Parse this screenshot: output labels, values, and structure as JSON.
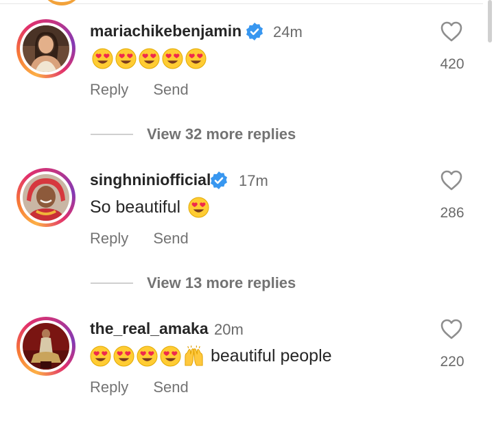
{
  "comments": [
    {
      "username": "mariachikebenjamin",
      "verified": true,
      "time": "24m",
      "text": "",
      "emojis": [
        "heart-eyes-emoji",
        "heart-eyes-emoji",
        "heart-eyes-emoji",
        "heart-eyes-emoji",
        "heart-eyes-emoji"
      ],
      "reply_label": "Reply",
      "send_label": "Send",
      "likes": "420",
      "view_more": "View 32 more replies"
    },
    {
      "username": "singhniniofficial",
      "verified": true,
      "time": "17m",
      "text": "So beautiful",
      "emojis": [
        "heart-eyes-emoji"
      ],
      "reply_label": "Reply",
      "send_label": "Send",
      "likes": "286",
      "view_more": "View 13 more replies"
    },
    {
      "username": "the_real_amaka",
      "verified": false,
      "time": "20m",
      "text": "beautiful people",
      "emojis": [
        "heart-eyes-emoji",
        "heart-eyes-emoji",
        "heart-eyes-emoji",
        "heart-eyes-emoji",
        "raising-hands-emoji"
      ],
      "reply_label": "Reply",
      "send_label": "Send",
      "likes": "220"
    }
  ],
  "colors": {
    "verified_blue": "#3897f0",
    "emoji_yellow": "#ffcc33",
    "heart_eyes_red": "#ef2a4c",
    "muted_text": "#737373"
  }
}
